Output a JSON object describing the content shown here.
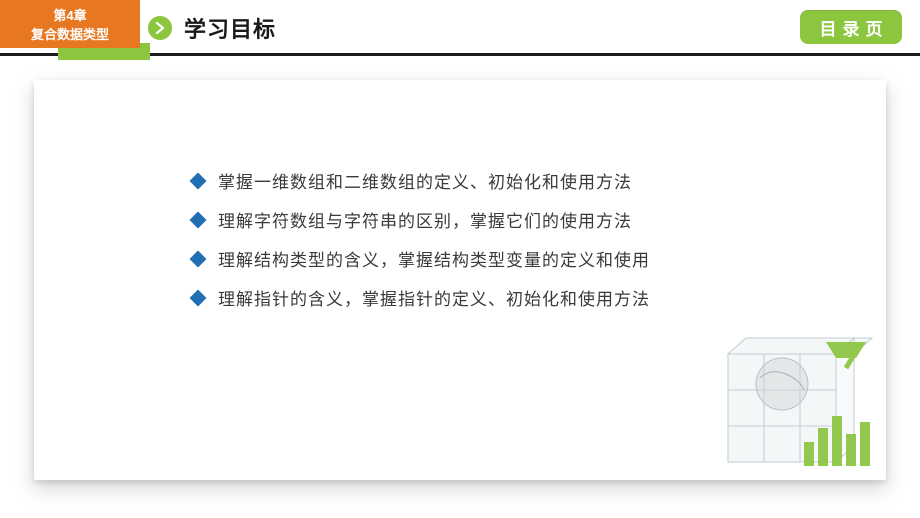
{
  "header": {
    "chapter_line1": "第4章",
    "chapter_line2": "复合数据类型",
    "title": "学习目标",
    "toc_label": "目录页"
  },
  "bullets": [
    "掌握一维数组和二维数组的定义、初始化和使用方法",
    "理解字符数组与字符串的区别，掌握它们的使用方法",
    "理解结构类型的含义，掌握结构类型变量的定义和使用",
    "理解指针的含义，掌握指针的定义、初始化和使用方法"
  ],
  "colors": {
    "orange": "#e87722",
    "green": "#8cc63f",
    "blue": "#1f6fb2",
    "text": "#3a3a3a"
  }
}
